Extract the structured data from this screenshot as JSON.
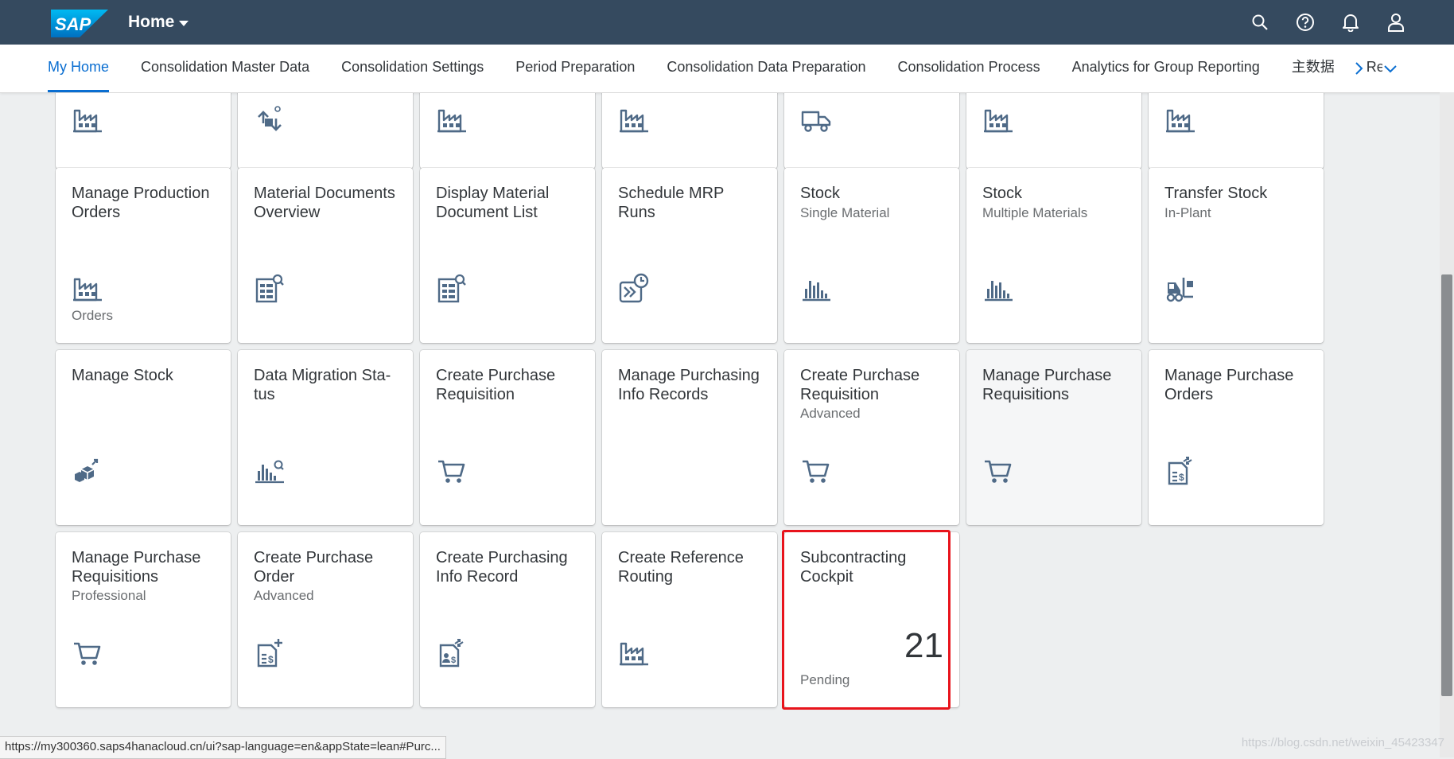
{
  "shell": {
    "logo_text": "SAP",
    "home_label": "Home",
    "icons": [
      "search-icon",
      "help-icon",
      "notification-bell-icon",
      "user-profile-icon"
    ]
  },
  "tabs": [
    {
      "label": "My Home",
      "active": true
    },
    {
      "label": "Consolidation Master Data"
    },
    {
      "label": "Consolidation Settings"
    },
    {
      "label": "Period Preparation"
    },
    {
      "label": "Consolidation Data Preparation"
    },
    {
      "label": "Consolidation Process"
    },
    {
      "label": "Analytics for Group Reporting"
    },
    {
      "label": "主数据"
    },
    {
      "label": "Re"
    }
  ],
  "top_partial_icons": [
    "factory-icon",
    "transfer-arrows-icon",
    "factory-icon",
    "factory-icon",
    "truck-icon",
    "factory-icon",
    "factory-icon"
  ],
  "tiles": [
    {
      "title": "Manage Production Orders",
      "subtitle": "",
      "icon": "factory-icon",
      "footer": "Orders"
    },
    {
      "title": "Material Documents Overview",
      "subtitle": "",
      "icon": "document-search-icon",
      "footer": ""
    },
    {
      "title": "Display Material Document List",
      "subtitle": "",
      "icon": "document-search-icon",
      "footer": ""
    },
    {
      "title": "Schedule MRP Runs",
      "subtitle": "",
      "icon": "schedule-run-icon",
      "footer": ""
    },
    {
      "title": "Stock",
      "subtitle": "Single Material",
      "icon": "bar-chart-icon",
      "footer": ""
    },
    {
      "title": "Stock",
      "subtitle": "Multiple Materials",
      "icon": "bar-chart-icon",
      "footer": ""
    },
    {
      "title": "Transfer Stock",
      "subtitle": "In-Plant",
      "icon": "forklift-icon",
      "footer": ""
    },
    {
      "title": "Manage Stock",
      "subtitle": "",
      "icon": "cubes-icon",
      "footer": ""
    },
    {
      "title": "Data Migration Sta-tus",
      "subtitle": "",
      "icon": "chart-search-icon",
      "footer": ""
    },
    {
      "title": "Create Purchase Requisition",
      "subtitle": "",
      "icon": "cart-icon",
      "footer": ""
    },
    {
      "title": "Manage Purchasing Info Records",
      "subtitle": "",
      "icon": "",
      "footer": ""
    },
    {
      "title": "Create Purchase Requisition",
      "subtitle": "Advanced",
      "icon": "cart-icon",
      "footer": ""
    },
    {
      "title": "Manage Purchase Requisitions",
      "subtitle": "",
      "icon": "cart-icon",
      "footer": ""
    },
    {
      "title": "Manage Purchase Orders",
      "subtitle": "",
      "icon": "purchase-order-icon",
      "footer": ""
    },
    {
      "title": "Manage Purchase Requisitions",
      "subtitle": "Professional",
      "icon": "cart-icon",
      "footer": ""
    },
    {
      "title": "Create Purchase Order",
      "subtitle": "Advanced",
      "icon": "create-order-icon",
      "footer": ""
    },
    {
      "title": "Create Purchasing Info Record",
      "subtitle": "",
      "icon": "info-record-icon",
      "footer": ""
    },
    {
      "title": "Create Reference Routing",
      "subtitle": "",
      "icon": "factory-icon",
      "footer": ""
    },
    {
      "title": "Subcontracting Cockpit",
      "subtitle": "",
      "icon": "",
      "footer": "Pending",
      "kpi": "21",
      "highlighted": true
    }
  ],
  "status_url": "https://my300360.saps4hanacloud.cn/ui?sap-language=en&appState=lean#Purc...",
  "watermark": "https://blog.csdn.net/weixin_45423347",
  "colors": {
    "shell": "#354a5f",
    "accent": "#0a6ed1",
    "icon": "#4f6a87",
    "highlight": "#e8141c"
  }
}
